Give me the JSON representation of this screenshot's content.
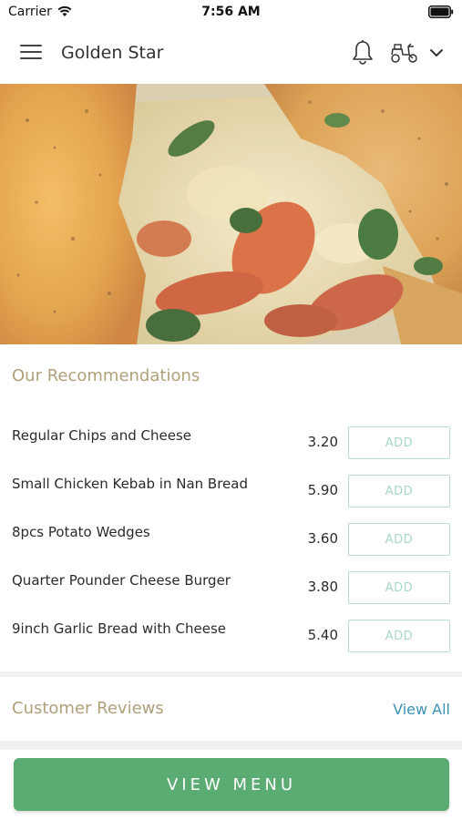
{
  "status_bar": {
    "carrier": "Carrier",
    "time": "7:56 AM"
  },
  "header": {
    "title": "Golden Star",
    "icons": [
      "menu-icon",
      "bell-icon",
      "scooter-icon",
      "chevron-down-icon"
    ]
  },
  "recommendations": {
    "title": "Our Recommendations",
    "items": [
      {
        "name": "Regular Chips and Cheese",
        "price": "3.20",
        "button": "ADD"
      },
      {
        "name": "Small Chicken Kebab in Nan Bread",
        "price": "5.90",
        "button": "ADD"
      },
      {
        "name": "8pcs Potato Wedges",
        "price": "3.60",
        "button": "ADD"
      },
      {
        "name": "Quarter Pounder Cheese Burger",
        "price": "3.80",
        "button": "ADD"
      },
      {
        "name": "9inch Garlic Bread with Cheese",
        "price": "5.40",
        "button": "ADD"
      }
    ]
  },
  "reviews": {
    "title": "Customer Reviews",
    "view_all": "View All"
  },
  "footer": {
    "view_menu": "VIEW MENU"
  },
  "colors": {
    "accent_green": "#5aac72",
    "section_title": "#b0a17a",
    "link_blue": "#3c93b8",
    "add_button_border": "#b9ddd0"
  }
}
